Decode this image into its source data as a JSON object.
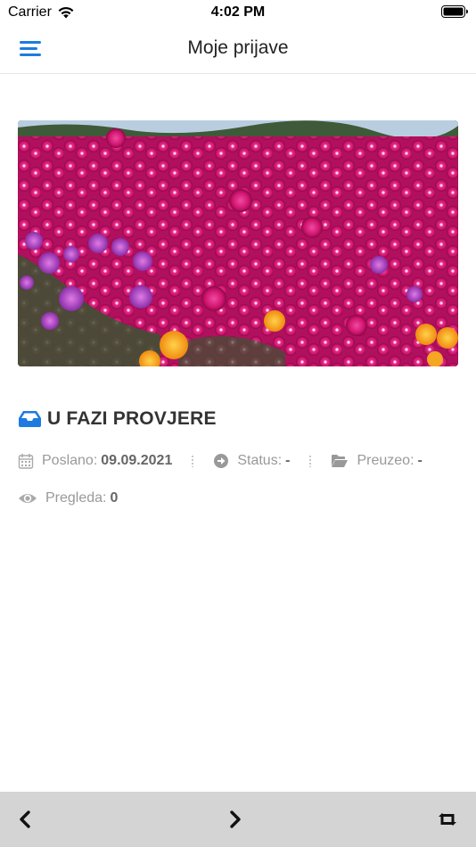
{
  "status_bar": {
    "carrier": "Carrier",
    "time": "4:02 PM",
    "wifi_icon": "wifi-icon",
    "battery_icon": "battery-icon"
  },
  "nav": {
    "title": "Moje prijave",
    "menu_icon": "hamburger-menu-icon",
    "accent_color": "#1e7be0"
  },
  "hero": {
    "description_icon": "flower-photo"
  },
  "application": {
    "status_title": "U FAZI PROVJERE",
    "status_icon": "inbox-icon",
    "status_icon_color": "#1e7be0",
    "sent_label": "Poslano:",
    "sent_value": "09.09.2021",
    "status_label": "Status:",
    "status_value": "-",
    "taken_label": "Preuzeo:",
    "taken_value": "-",
    "views_label": "Pregleda:",
    "views_value": "0"
  },
  "toolbar": {
    "back_icon": "chevron-left-icon",
    "forward_icon": "chevron-right-icon",
    "refresh_icon": "retweet-icon",
    "background": "#d4d4d4"
  }
}
